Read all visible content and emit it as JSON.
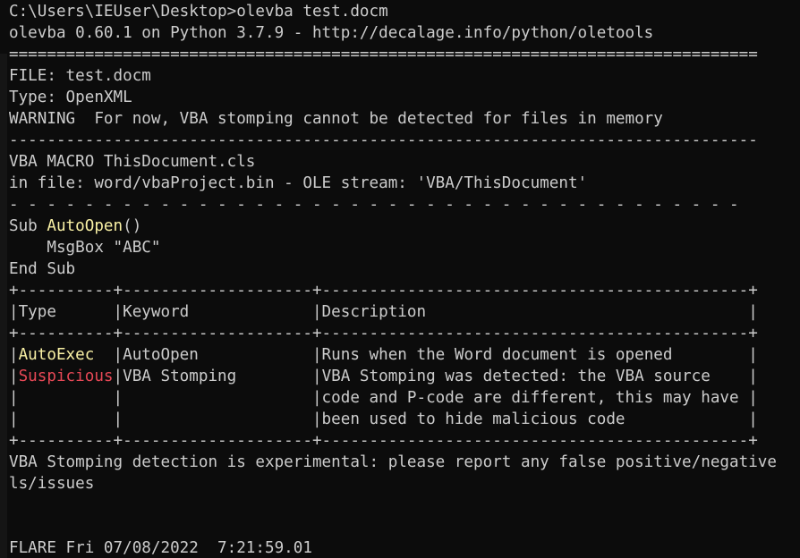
{
  "terminal": {
    "lines": [
      [
        {
          "t": "C:\\Users\\IEUser\\Desktop>olevba test.docm"
        }
      ],
      [
        {
          "t": "olevba 0.60.1 on Python 3.7.9 - http://decalage.info/python/oletools"
        }
      ],
      [
        {
          "t": "==============================================================================="
        }
      ],
      [
        {
          "t": "FILE: test.docm"
        }
      ],
      [
        {
          "t": "Type: OpenXML"
        }
      ],
      [
        {
          "t": "WARNING  For now, VBA stomping cannot be detected for files in memory"
        }
      ],
      [
        {
          "t": "-------------------------------------------------------------------------------"
        }
      ],
      [
        {
          "t": "VBA MACRO ThisDocument.cls"
        }
      ],
      [
        {
          "t": "in file: word/vbaProject.bin - OLE stream: 'VBA/ThisDocument'"
        }
      ],
      [
        {
          "t": "- - - - - - - - - - - - - - - - - - - - - - - - - - - - - - - - - - - - - - -"
        }
      ],
      [
        {
          "t": "Sub "
        },
        {
          "t": "AutoOpen",
          "c": "yellow"
        },
        {
          "t": "()"
        }
      ],
      [
        {
          "t": "    MsgBox \"ABC\""
        }
      ],
      [
        {
          "t": "End Sub"
        }
      ],
      [
        {
          "t": "+----------+--------------------+---------------------------------------------+"
        }
      ],
      [
        {
          "t": "|Type      |Keyword             |Description                                  |"
        }
      ],
      [
        {
          "t": "+----------+--------------------+---------------------------------------------+"
        }
      ],
      [
        {
          "t": "|"
        },
        {
          "t": "AutoExec",
          "c": "yellow"
        },
        {
          "t": "  |AutoOpen            |Runs when the Word document is opened        |"
        }
      ],
      [
        {
          "t": "|"
        },
        {
          "t": "Suspicious",
          "c": "red"
        },
        {
          "t": "|VBA Stomping        |VBA Stomping was detected: the VBA source    |"
        }
      ],
      [
        {
          "t": "|          |                    |code and P-code are different, this may have |"
        }
      ],
      [
        {
          "t": "|          |                    |been used to hide malicious code             |"
        }
      ],
      [
        {
          "t": "+----------+--------------------+---------------------------------------------+"
        }
      ],
      [
        {
          "t": "VBA Stomping detection is experimental: please report any false positive/negative"
        }
      ],
      [
        {
          "t": "ls/issues"
        }
      ],
      [
        {
          "t": ""
        }
      ],
      [
        {
          "t": ""
        }
      ],
      [
        {
          "t": "FLARE Fri 07/08/2022  7:21:59.01"
        }
      ]
    ]
  },
  "colors": {
    "background": "#0c0c0c",
    "foreground": "#cccccc",
    "yellow": "#f9f1a5",
    "red": "#e74856"
  }
}
